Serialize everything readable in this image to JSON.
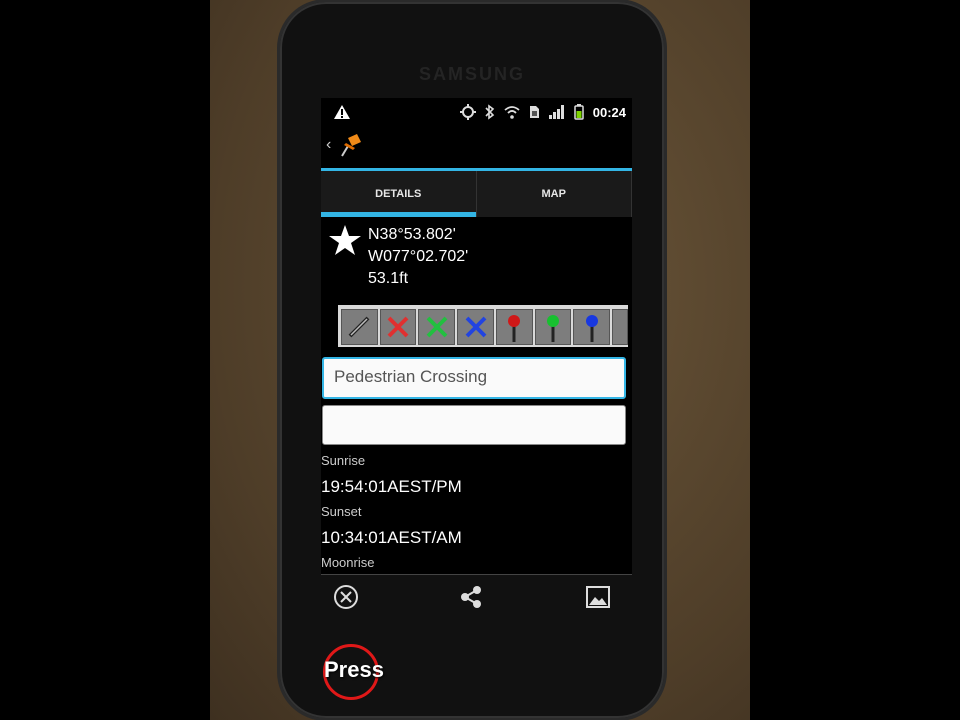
{
  "device": {
    "brand": "SAMSUNG"
  },
  "status_bar": {
    "time": "00:24",
    "icons": [
      "warning-icon",
      "gps-icon",
      "bluetooth-icon",
      "wifi-icon",
      "sim-icon",
      "signal-icon",
      "battery-icon"
    ]
  },
  "action_bar": {
    "back_glyph": "‹",
    "app_icon": "pushpin-icon"
  },
  "tabs": [
    {
      "label": "DETAILS",
      "active": true
    },
    {
      "label": "MAP",
      "active": false
    }
  ],
  "waypoint": {
    "lat": "N38°53.802'",
    "lon": "W077°02.702'",
    "elevation": "53.1ft"
  },
  "symbol_palette": [
    "pin-gray-icon",
    "pin-red-x-icon",
    "pin-green-x-icon",
    "pin-blue-x-icon",
    "pin-red-icon",
    "pin-green-icon",
    "pin-blue-icon",
    "pin-more-icon"
  ],
  "name_field": {
    "value": "Pedestrian Crossing"
  },
  "notes_field": {
    "value": ""
  },
  "astro": [
    {
      "label": "Sunrise",
      "value": "19:54:01AEST/PM"
    },
    {
      "label": "Sunset",
      "value": "10:34:01AEST/AM"
    },
    {
      "label": "Moonrise",
      "value": ""
    }
  ],
  "bottom_bar": [
    "delete-icon",
    "share-icon",
    "image-icon"
  ],
  "overlay": {
    "press_label": "Press"
  },
  "colors": {
    "accent": "#33b5e5",
    "overlay_ring": "#e01818"
  }
}
